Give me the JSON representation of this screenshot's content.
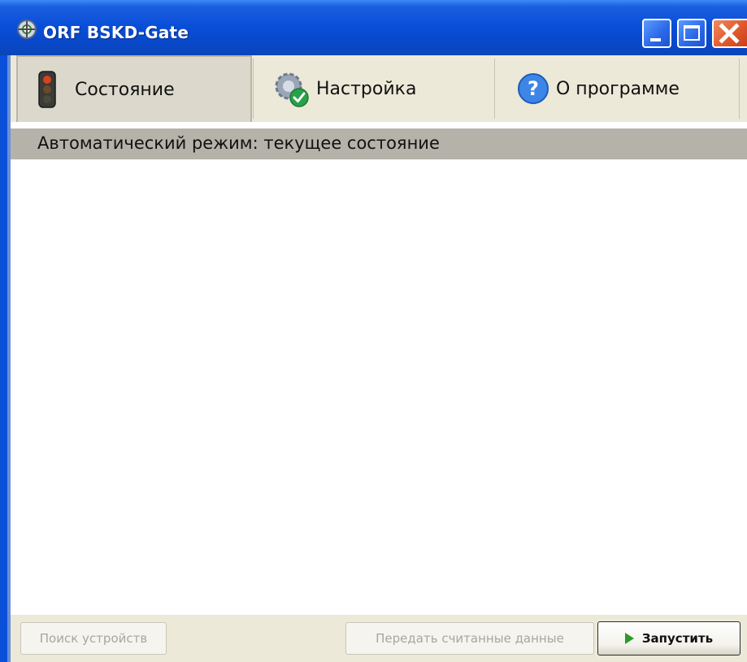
{
  "window": {
    "title": "ORF BSKD-Gate",
    "app_icon": "snowflake-gear-icon",
    "controls": [
      "minimize-icon",
      "maximize-icon",
      "close-icon"
    ]
  },
  "tabs": [
    {
      "label": "Состояние",
      "icon": "traffic-light-icon",
      "active": true
    },
    {
      "label": "Настройка",
      "icon": "gears-check-icon",
      "active": false
    },
    {
      "label": "О программе",
      "icon": "help-question-icon",
      "active": false
    }
  ],
  "main": {
    "section_header": "Автоматический режим: текущее состояние"
  },
  "footer": {
    "search_devices_label": "Поиск устройств",
    "transfer_data_label": "Передать считанные данные",
    "start_label": "Запустить",
    "start_icon": "play-icon"
  },
  "colors": {
    "titlebar": "#0a4fd8",
    "close_button": "#e05a2c",
    "tab_background": "#ece9d8",
    "section_header": "#b4b2a9",
    "play_icon": "#2a9a2a"
  }
}
